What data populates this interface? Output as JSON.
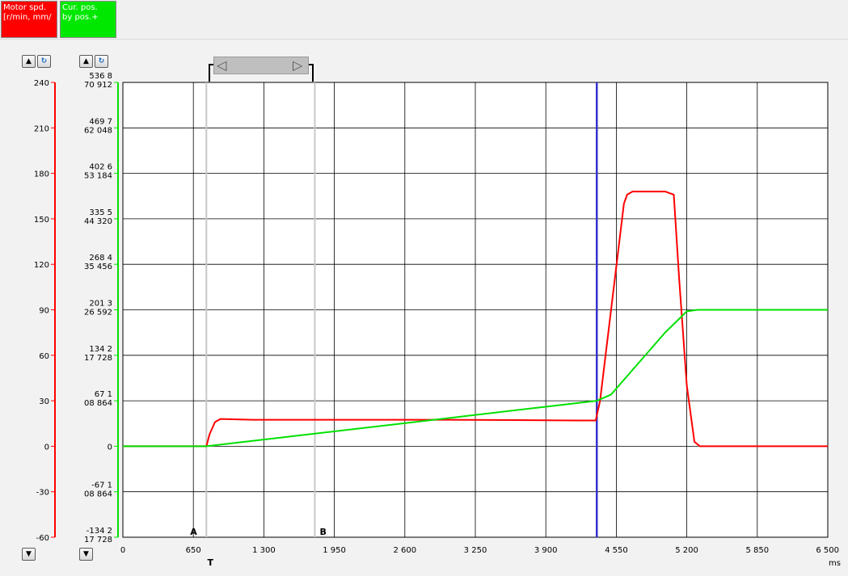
{
  "legend": {
    "series1_label": "Motor spd.\n[r/min, mm/",
    "series2_label": "Cur. pos.\nby pos.+"
  },
  "axis_buttons": {
    "up_icon": "triangle-up-icon",
    "reset_icon": "reset-icon",
    "down_icon": "triangle-down-icon"
  },
  "colors": {
    "speed": "#ff0000",
    "position": "#00e000",
    "cursor": "#3333cc",
    "grid": "#000000",
    "marker": "#c8c8c8"
  },
  "chart_data": {
    "type": "line",
    "x_unit_label": "ms",
    "xlim": [
      0,
      6500
    ],
    "x_ticks": [
      0,
      650,
      1300,
      1950,
      2600,
      3250,
      3900,
      4550,
      5200,
      5850,
      6500
    ],
    "x_tick_labels": [
      "0",
      "650",
      "1 300",
      "1 950",
      "2 600",
      "3 250",
      "3 900",
      "4 550",
      "5 200",
      "5 850",
      "6 500"
    ],
    "y1": {
      "ylim": [
        -60,
        240
      ],
      "ticks": [
        "240",
        "210",
        "180",
        "150",
        "120",
        "90",
        "60",
        "30",
        "0",
        "-30",
        "-60"
      ]
    },
    "y2": {
      "tick_labels_top": [
        "536 8",
        "469 7",
        "402 6",
        "335 5",
        "268 4",
        "201 3",
        "134 2",
        "67 1",
        "",
        "-67 1",
        "-134 2"
      ],
      "tick_labels_bottom": [
        "70 912",
        "62 048",
        "53 184",
        "44 320",
        "35 456",
        "26 592",
        "17 728",
        "08 864",
        "0",
        "08 864",
        "17 728"
      ]
    },
    "markers": [
      {
        "label": "A",
        "x": 770
      },
      {
        "label": "B",
        "x": 1770
      }
    ],
    "trigger_label": "T",
    "cursor_x": 4370,
    "series": [
      {
        "key": "speed",
        "points": [
          [
            0,
            0
          ],
          [
            770,
            0
          ],
          [
            800,
            8
          ],
          [
            850,
            16
          ],
          [
            900,
            18
          ],
          [
            1200,
            17.5
          ],
          [
            2000,
            17.5
          ],
          [
            3000,
            17.5
          ],
          [
            4200,
            17
          ],
          [
            4360,
            17
          ],
          [
            4400,
            30
          ],
          [
            4620,
            160
          ],
          [
            4650,
            166
          ],
          [
            4700,
            168
          ],
          [
            5000,
            168
          ],
          [
            5080,
            166
          ],
          [
            5130,
            110
          ],
          [
            5200,
            40
          ],
          [
            5270,
            3
          ],
          [
            5320,
            0
          ],
          [
            6500,
            0
          ]
        ]
      },
      {
        "key": "position",
        "points": [
          [
            0,
            0
          ],
          [
            770,
            0
          ],
          [
            4370,
            30
          ],
          [
            4500,
            34
          ],
          [
            5000,
            75
          ],
          [
            5200,
            89
          ],
          [
            5300,
            90
          ],
          [
            6500,
            90
          ]
        ]
      }
    ]
  }
}
